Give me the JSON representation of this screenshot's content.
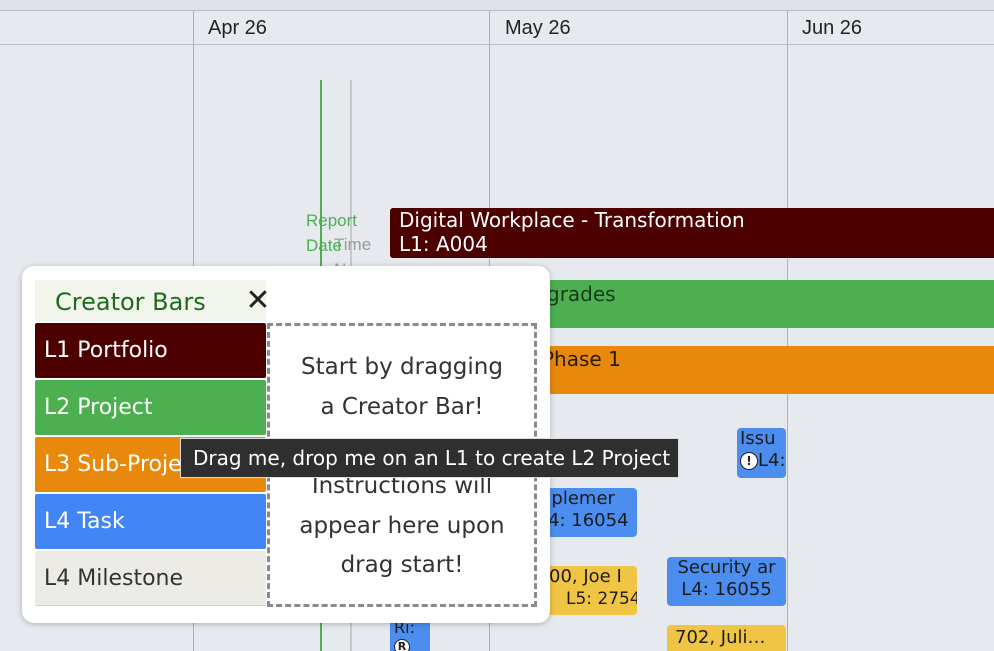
{
  "timeline": {
    "months": [
      "Apr 26",
      "May 26",
      "Jun 26"
    ],
    "markers": {
      "report_date": "Report\nDate",
      "time_now": "Time\nNow"
    }
  },
  "bars": {
    "portfolio": {
      "title": "Digital Workplace - Transformation",
      "code": "L1: A004",
      "color": "#4d0000"
    },
    "project": {
      "title": "grades",
      "color": "#4caf50"
    },
    "subproject": {
      "title": "Phase 1",
      "color": "#e8890c"
    }
  },
  "task_cards": [
    {
      "title": "Issu",
      "code": "L4:"
    },
    {
      "title": "nplemer",
      "code": "L4: 16054"
    },
    {
      "title": "Security ar",
      "code": "L4: 16055"
    },
    {
      "title": "00, Joe I",
      "code": "L5: 2754"
    },
    {
      "title": "702, Juli…",
      "code": ""
    },
    {
      "title": "Ri:",
      "code": ""
    }
  ],
  "creator_panel": {
    "title": "Creator Bars",
    "items": [
      {
        "label": "L1 Portfolio",
        "color": "#4d0000",
        "text_color": "#ffffff"
      },
      {
        "label": "L2 Project",
        "color": "#4caf50",
        "text_color": "#ffffff"
      },
      {
        "label": "L3 Sub-Project",
        "color": "#e8890c",
        "text_color": "#ffffff"
      },
      {
        "label": "L4 Task",
        "color": "#4285f4",
        "text_color": "#ffffff"
      },
      {
        "label": "L4 Milestone",
        "color": "#ecebe6",
        "text_color": "#333333"
      }
    ],
    "drop_zone": {
      "line1": "Start by dragging",
      "line2": "a Creator Bar!",
      "line3": "Instructions will",
      "line4": "appear here upon",
      "line5": "drag start!"
    },
    "tooltip": "Drag me, drop me on an L1 to create L2 Project"
  }
}
